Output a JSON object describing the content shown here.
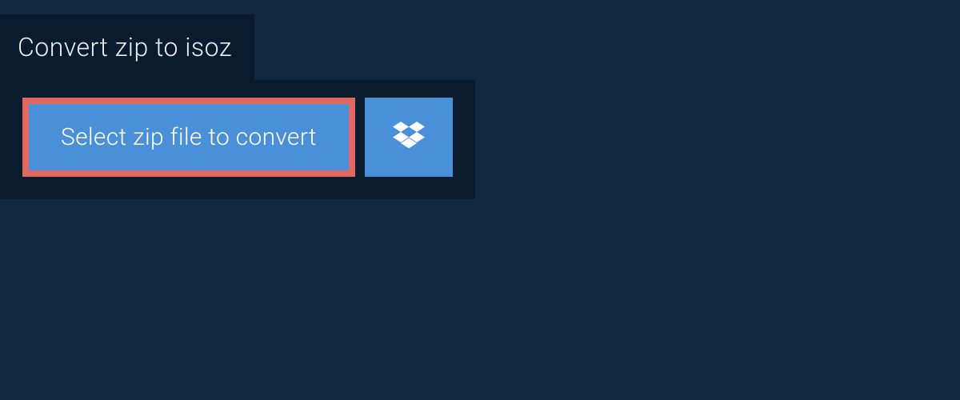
{
  "header": {
    "title": "Convert zip to isoz"
  },
  "actions": {
    "select_file_label": "Select zip file to convert"
  },
  "colors": {
    "background": "#11283f",
    "panel": "#0a1b2e",
    "button": "#4a90d9",
    "highlight_border": "#e06860",
    "text_light": "#ffffff"
  }
}
